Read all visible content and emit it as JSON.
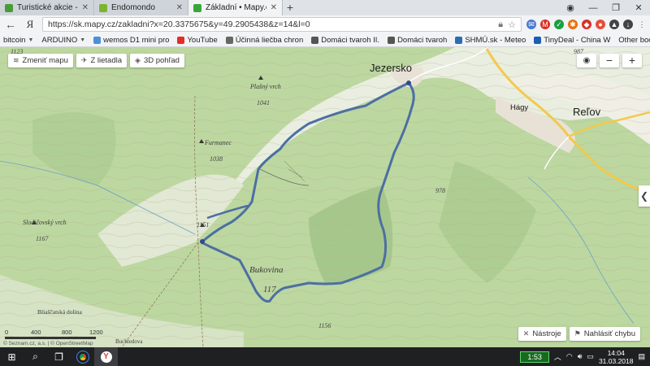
{
  "browser": {
    "tabs": [
      {
        "title": "Turistické akcie - Turistický p",
        "favicon_color": "#4a9a3a",
        "active": false
      },
      {
        "title": "Endomondo",
        "favicon_color": "#7ab531",
        "active": false
      },
      {
        "title": "Základní • Mapy.cz",
        "favicon_color": "#3aa63a",
        "active": true
      }
    ],
    "new_tab": "+",
    "url": "https://sk.mapy.cz/zakladni?x=20.3375675&y=49.2905438&z=14&l=0",
    "bookmarks": [
      {
        "label": "bitcoin",
        "icon_color": "#f7931a",
        "has_caret": true
      },
      {
        "label": "ARDUINO",
        "icon_color": "#f2f3f5",
        "has_caret": true
      },
      {
        "label": "wemos D1 mini pro",
        "icon_color": "#4a90d9",
        "has_caret": false
      },
      {
        "label": "YouTube",
        "icon_color": "#e52d27",
        "has_caret": false
      },
      {
        "label": "Účinná liečba chron",
        "icon_color": "#666666",
        "has_caret": false
      },
      {
        "label": "Domáci tvaroh II.",
        "icon_color": "#555555",
        "has_caret": false
      },
      {
        "label": "Domáci tvaroh",
        "icon_color": "#555555",
        "has_caret": false
      },
      {
        "label": "SHMÚ.sk - Meteo",
        "icon_color": "#2a6db5",
        "has_caret": false
      },
      {
        "label": "TinyDeal - China W",
        "icon_color": "#1a5fb4",
        "has_caret": false
      }
    ],
    "other_bookmarks": "Other bookmarks",
    "extension_colors": [
      "#4a7bd0",
      "#d93025",
      "#1a9e3f",
      "#e8710a",
      "#d93025",
      "#e74c3c",
      "#444444"
    ]
  },
  "map": {
    "controls": {
      "change_map": "Zmeniť mapu",
      "from_plane": "Z lietadla",
      "view_3d": "3D pohľad",
      "zoom_out": "−",
      "zoom_in": "+",
      "tools": "Nástroje",
      "report_error": "Nahlásiť chybu"
    },
    "towns": {
      "jezersko": "Jezersko",
      "relov": "Reľov",
      "hagy": "Hágy"
    },
    "peaks": {
      "plasny_name": "Plašný vrch",
      "plasny_elev": "1041",
      "furmanec_name": "Furmanec",
      "furmanec_elev": "1038",
      "slodicovsky_name": "Slodičovský vrch",
      "slodicovsky_elev": "1167",
      "bukovina_name": "Bukovina",
      "bukovina_elev": "117",
      "elev_1151": "1151",
      "elev_978": "978",
      "elev_1156": "1156",
      "elev_987": "987",
      "elev_1123": "1123"
    },
    "features": {
      "dolina": "Bliaščatská dolina",
      "buchtedova": "Buchtedova"
    },
    "scale_labels": [
      "0",
      "400",
      "800",
      "1200"
    ],
    "copyright": "© Seznam.cz, a.s. | © OpenStreetMap",
    "route_color": "#4c6fa3"
  },
  "taskbar": {
    "battery": "1:53",
    "time": "14:04",
    "date": "31.03.2018"
  }
}
